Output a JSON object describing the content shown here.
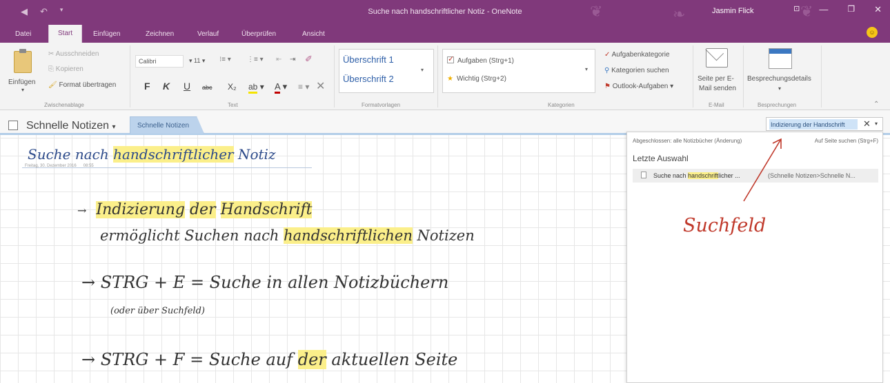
{
  "window": {
    "title": "Suche nach handschriftlicher Notiz - OneNote",
    "user": "Jasmin Flick"
  },
  "tabs": [
    "Datei",
    "Start",
    "Einfügen",
    "Zeichnen",
    "Verlauf",
    "Überprüfen",
    "Ansicht"
  ],
  "ribbon": {
    "clipboard": {
      "paste": "Einfügen",
      "cut": "Ausschneiden",
      "copy": "Kopieren",
      "format_painter": "Format übertragen",
      "group": "Zwischenablage"
    },
    "text": {
      "font": "Calibri",
      "size": "11",
      "bold": "F",
      "italic": "K",
      "underline": "U",
      "strike": "abc",
      "subscript": "X₂",
      "group": "Text"
    },
    "styles": {
      "heading1": "Überschrift 1",
      "heading2": "Überschrift 2",
      "group": "Formatvorlagen"
    },
    "tags": {
      "todo": "Aufgaben (Strg+1)",
      "important": "Wichtig (Strg+2)",
      "task_category": "Aufgabenkategorie",
      "find_tags": "Kategorien suchen",
      "outlook_tasks": "Outlook-Aufgaben",
      "group": "Kategorien"
    },
    "email": {
      "send_line1": "Seite per E-",
      "send_line2": "Mail senden",
      "group": "E-Mail"
    },
    "meetings": {
      "details": "Besprechungsdetails",
      "group": "Besprechungen"
    }
  },
  "notebook": {
    "name": "Schnelle Notizen",
    "section": "Schnelle Notizen"
  },
  "search": {
    "value": "Indizierung der Handschrift",
    "scope": "Abgeschlossen: alle Notizbücher (Änderung)",
    "page_search": "Auf Seite suchen (Strg+F)",
    "recent_header": "Letzte Auswahl",
    "result_prefix": "Suche nach ",
    "result_highlight": "handschrift",
    "result_suffix": "licher ...",
    "result_path": "(Schnelle Notizen>Schnelle N..."
  },
  "page": {
    "title_prefix": "Suche nach ",
    "title_highlight": "handschriftlicher",
    "title_suffix": " Notiz",
    "date": "Freitag, 30. Dezember 2016",
    "time": "08:55",
    "line1_arrow": "→",
    "line1_h1": "Indizierung",
    "line1_h2": "der",
    "line1_h3": "Handschrift",
    "line2_a": "ermöglicht Suchen nach ",
    "line2_h": "handschriftlichen",
    "line2_b": " Notizen",
    "line3": "→ STRG + E  =  Suche in allen Notizbüchern",
    "line4": "(oder über Suchfeld)",
    "line5_a": "→ STRG + F  =  Suche auf ",
    "line5_h": "der",
    "line5_b": " aktuellen Seite",
    "annotation": "Suchfeld"
  }
}
